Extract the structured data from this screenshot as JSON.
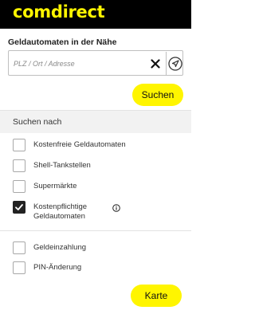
{
  "colors": {
    "brand_yellow": "#fff500",
    "topbar_bg": "#000000",
    "checkbox_checked": "#222222"
  },
  "header": {
    "logo_text": "comdirect"
  },
  "search": {
    "section_title": "Geldautomaten in der Nähe",
    "placeholder": "PLZ / Ort / Adresse",
    "value": "",
    "clear_icon": "close-icon",
    "locate_icon": "navigation-arrow-icon",
    "button_label": "Suchen"
  },
  "filters": {
    "header_label": "Suchen nach",
    "groups": [
      [
        {
          "label": "Kostenfreie Geldautomaten",
          "checked": false
        },
        {
          "label": "Shell-Tankstellen",
          "checked": false
        },
        {
          "label": "Supermärkte",
          "checked": false
        },
        {
          "label": "Kostenpflichtige Geldautomaten",
          "checked": true,
          "info_icon": "info-icon"
        }
      ],
      [
        {
          "label": "Geldeinzahlung",
          "checked": false
        },
        {
          "label": "PIN-Änderung",
          "checked": false
        }
      ]
    ]
  },
  "map_button_label": "Karte"
}
